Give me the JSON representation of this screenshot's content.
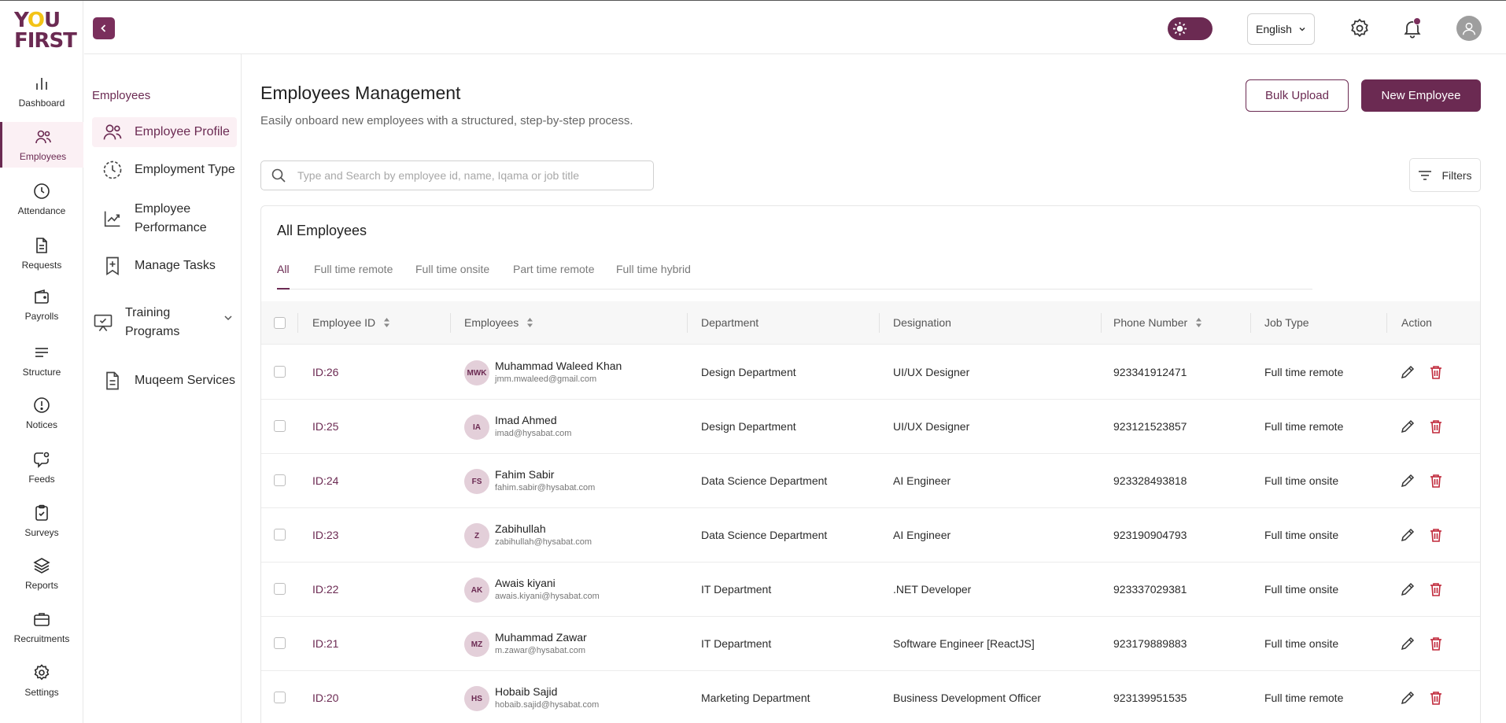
{
  "brand": {
    "logo_line1": "YOU",
    "logo_line2": "FIRST"
  },
  "rail": [
    {
      "label": "Dashboard",
      "icon": "chart-icon"
    },
    {
      "label": "Employees",
      "icon": "users-icon",
      "active": true
    },
    {
      "label": "Attendance",
      "icon": "clock-icon"
    },
    {
      "label": "Requests",
      "icon": "document-icon"
    },
    {
      "label": "Payrolls",
      "icon": "wallet-icon"
    },
    {
      "label": "Structure",
      "icon": "list-icon"
    },
    {
      "label": "Notices",
      "icon": "alert-icon"
    },
    {
      "label": "Feeds",
      "icon": "chat-icon"
    },
    {
      "label": "Surveys",
      "icon": "clipboard-icon"
    },
    {
      "label": "Reports",
      "icon": "layers-icon"
    },
    {
      "label": "Recruitments",
      "icon": "briefcase-icon"
    },
    {
      "label": "Settings",
      "icon": "gear-icon"
    }
  ],
  "header": {
    "language": "English"
  },
  "subnav": {
    "title": "Employees",
    "items": [
      {
        "label": "Employee Profile",
        "active": true
      },
      {
        "label": "Employment Type"
      },
      {
        "label": "Employee Performance"
      },
      {
        "label": "Manage Tasks"
      },
      {
        "label": "Training Programs"
      },
      {
        "label": "Muqeem Services"
      }
    ]
  },
  "main": {
    "title": "Employees Management",
    "subtitle": "Easily onboard new employees with a structured, step-by-step process.",
    "bulk_upload": "Bulk Upload",
    "new_employee": "New Employee",
    "search_placeholder": "Type and Search by employee id, name, Iqama or job title",
    "filters": "Filters"
  },
  "table": {
    "title": "All Employees",
    "tabs": [
      "All",
      "Full time remote",
      "Full time onsite",
      "Part time remote",
      "Full time hybrid"
    ],
    "columns": [
      "Employee ID",
      "Employees",
      "Department",
      "Designation",
      "Phone Number",
      "Job Type",
      "Action"
    ],
    "rows": [
      {
        "id": "ID:26",
        "initials": "MWK",
        "name": "Muhammad Waleed Khan",
        "email": "jmm.mwaleed@gmail.com",
        "department": "Design Department",
        "designation": "UI/UX Designer",
        "phone": "923341912471",
        "job_type": "Full time remote"
      },
      {
        "id": "ID:25",
        "initials": "IA",
        "name": "Imad Ahmed",
        "email": "imad@hysabat.com",
        "department": "Design Department",
        "designation": "UI/UX Designer",
        "phone": "923121523857",
        "job_type": "Full time remote"
      },
      {
        "id": "ID:24",
        "initials": "FS",
        "name": "Fahim Sabir",
        "email": "fahim.sabir@hysabat.com",
        "department": "Data Science Department",
        "designation": "AI Engineer",
        "phone": "923328493818",
        "job_type": "Full time onsite"
      },
      {
        "id": "ID:23",
        "initials": "Z",
        "name": "Zabihullah",
        "email": "zabihullah@hysabat.com",
        "department": "Data Science Department",
        "designation": "AI Engineer",
        "phone": "923190904793",
        "job_type": "Full time onsite"
      },
      {
        "id": "ID:22",
        "initials": "AK",
        "name": "Awais kiyani",
        "email": "awais.kiyani@hysabat.com",
        "department": "IT Department",
        "designation": ".NET Developer",
        "phone": "923337029381",
        "job_type": "Full time onsite"
      },
      {
        "id": "ID:21",
        "initials": "MZ",
        "name": "Muhammad Zawar",
        "email": "m.zawar@hysabat.com",
        "department": "IT Department",
        "designation": "Software Engineer [ReactJS]",
        "phone": "923179889883",
        "job_type": "Full time onsite"
      },
      {
        "id": "ID:20",
        "initials": "HS",
        "name": "Hobaib Sajid",
        "email": "hobaib.sajid@hysabat.com",
        "department": "Marketing Department",
        "designation": "Business Development Officer",
        "phone": "923139951535",
        "job_type": "Full time remote"
      }
    ]
  },
  "colors": {
    "brand": "#6b2a52",
    "brand_accent": "#f3c316",
    "delete": "#c0283a",
    "active_bg": "#fbf0f4"
  }
}
